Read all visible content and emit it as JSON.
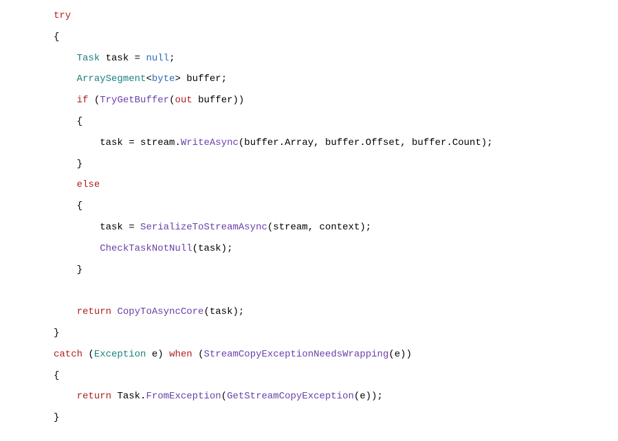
{
  "code": {
    "tokens": {
      "try": "try",
      "catch": "catch",
      "if": "if",
      "else": "else",
      "return": "return",
      "when": "when",
      "null": "null",
      "out": "out",
      "Task": "Task",
      "ArraySegment": "ArraySegment",
      "byte": "byte",
      "Exception": "Exception",
      "task_var": "task",
      "buffer_var": "buffer",
      "stream_var": "stream",
      "context_var": "context",
      "e_var": "e",
      "TryGetBuffer": "TryGetBuffer",
      "WriteAsync": "WriteAsync",
      "SerializeToStreamAsync": "SerializeToStreamAsync",
      "CheckTaskNotNull": "CheckTaskNotNull",
      "CopyToAsyncCore": "CopyToAsyncCore",
      "StreamCopyExceptionNeedsWrapping": "StreamCopyExceptionNeedsWrapping",
      "FromException": "FromException",
      "GetStreamCopyException": "GetStreamCopyException",
      "Array_prop": "Array",
      "Offset_prop": "Offset",
      "Count_prop": "Count",
      "eq": " = ",
      "semi": ";",
      "lbrace": "{",
      "rbrace": "}",
      "lparen": "(",
      "rparen": ")",
      "lt": "<",
      "gt": ">",
      "comma": ", ",
      "dot": ".",
      "space": " "
    }
  }
}
